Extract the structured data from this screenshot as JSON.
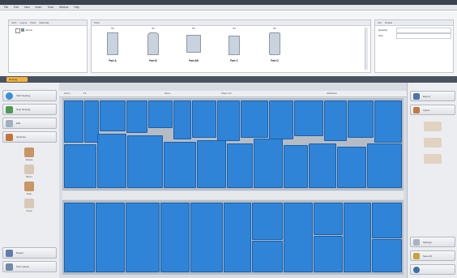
{
  "window": {
    "title": ""
  },
  "menu": [
    "File",
    "Edit",
    "View",
    "Insert",
    "Tools",
    "Window",
    "Help"
  ],
  "top_panel": {
    "left_tabs": [
      "Jobs",
      "Layout",
      "Parts",
      "Materials"
    ],
    "tree_item": "Demo",
    "parts_tab": "Parts",
    "parts": [
      {
        "label": "Part A",
        "code": "ST"
      },
      {
        "label": "Part B",
        "code": "ST"
      },
      {
        "label": "Part AB",
        "code": "ST"
      },
      {
        "label": "Part C",
        "code": "ST"
      },
      {
        "label": "Part D",
        "code": "ST"
      }
    ],
    "right_tabs": [
      "Info",
      "Details"
    ],
    "right_fields": [
      "Quantity",
      "Size"
    ]
  },
  "active_tab": "Nesting",
  "left_sidebar": {
    "buttons": [
      "Start Nesting",
      "Stop Nesting",
      "Edit",
      "Optimize"
    ],
    "tools": [
      "Rotate",
      "Mirror",
      "Align",
      "Snap"
    ],
    "bottom_buttons": [
      "Report",
      "Print Labels"
    ]
  },
  "canvas_toolbar": [
    "Zoom",
    "Fit",
    "Move",
    "Sheet 1/2",
    "Utilization"
  ],
  "right_sidebar": {
    "buttons": [
      "Export",
      "Import",
      "Settings",
      "Save All"
    ],
    "tools": [
      "Tool 1",
      "Tool 2",
      "Tool 3"
    ]
  },
  "colors": {
    "part_fill": "#2f84d8",
    "sheet_bg": "#b6bcc4",
    "accent_tab": "#f3b13b"
  }
}
